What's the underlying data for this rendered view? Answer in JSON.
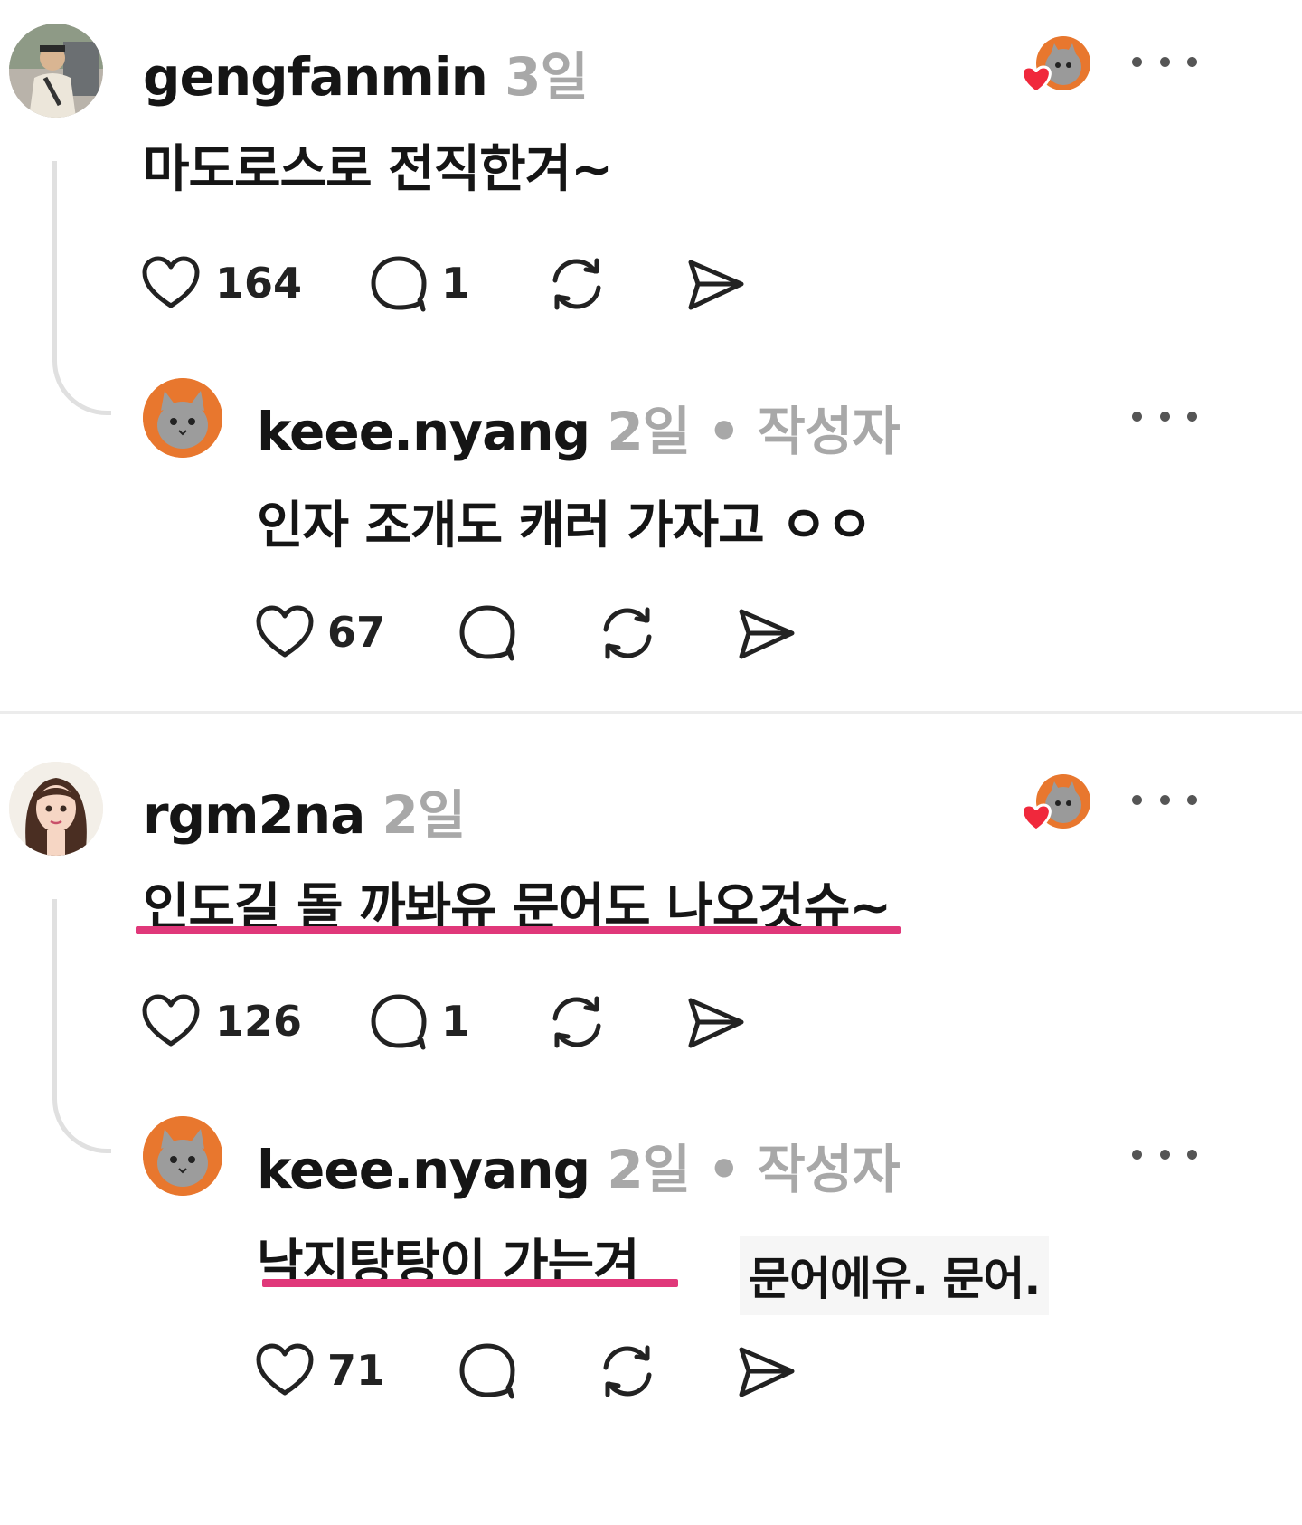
{
  "posts": [
    {
      "username": "gengfanmin",
      "time": "3일",
      "text": "마도로스로 전직한겨~",
      "likes": "164",
      "replies": "1",
      "reply": {
        "username": "keee.nyang",
        "meta": "2일 • 작성자",
        "text": "인자 조개도 캐러 가자고 ㅇㅇ",
        "likes": "67"
      }
    },
    {
      "username": "rgm2na",
      "time": "2일",
      "text": "인도길 돌 까봐유 문어도 나오것슈~",
      "likes": "126",
      "replies": "1",
      "reply": {
        "username": "keee.nyang",
        "meta": "2일 • 작성자",
        "text": "낙지탕탕이 가는겨",
        "likes": "71"
      }
    }
  ],
  "caption": "문어에유. 문어.",
  "icons": {
    "like": "heart-icon",
    "comment": "comment-bubble-icon",
    "repost": "repost-icon",
    "share": "send-icon",
    "more": "more-options-icon",
    "liked_by_author": "author-liked-heart-icon"
  },
  "colors": {
    "accent_underline": "#e0387a",
    "heart_red": "#f0283c",
    "avatar_orange": "#e8772e",
    "meta_gray": "#a8a8a8"
  }
}
